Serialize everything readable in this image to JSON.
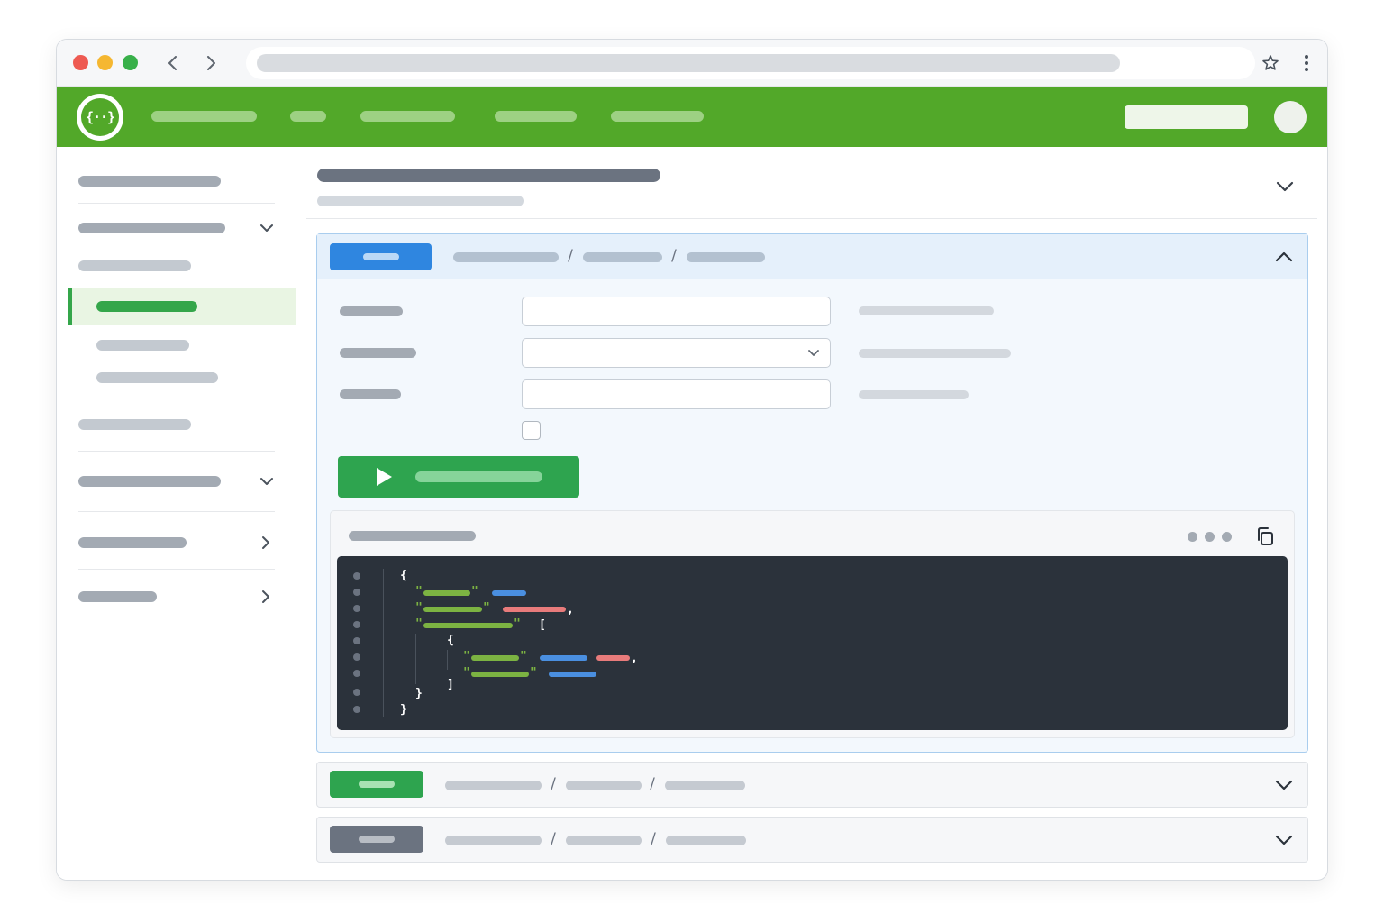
{
  "browser": {
    "traffic_lights": {
      "close": "#ee5a52",
      "minimize": "#f5b731",
      "zoom": "#38b04a"
    },
    "icons": {
      "back": "chevron-left-icon",
      "forward": "chevron-right-icon",
      "bookmark": "star-icon",
      "menu": "kebab-icon"
    }
  },
  "app": {
    "logo_glyph": "{··}",
    "brand_color": "#52a829",
    "accent_green": "#2ea44f",
    "accent_blue": "#2f86e0"
  },
  "code": {
    "open_brace": "{",
    "close_brace": "}",
    "open_bracket": "[",
    "close_bracket": "]",
    "quote": "\"",
    "comma": ","
  },
  "operations": [
    {
      "method_color": "#2f86e0",
      "expanded": true
    },
    {
      "method_color": "#2ea44f",
      "expanded": false
    },
    {
      "method_color": "#6b7380",
      "expanded": false
    }
  ]
}
